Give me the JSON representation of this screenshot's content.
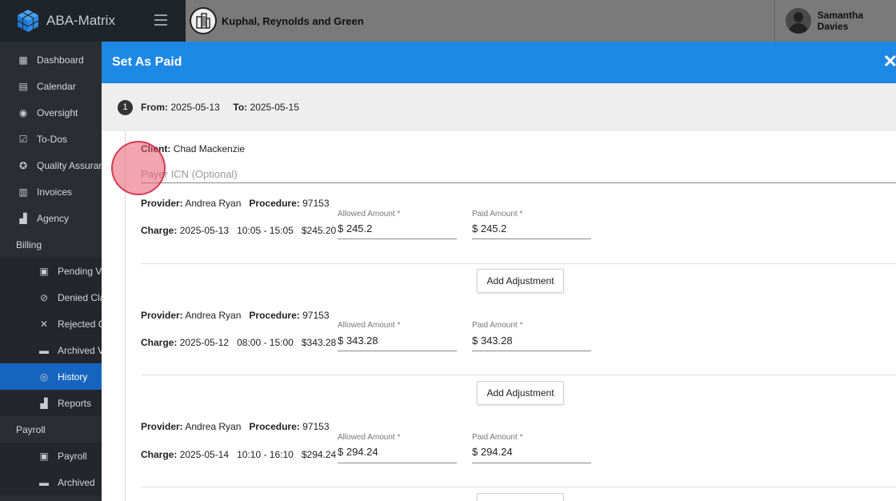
{
  "app": {
    "name": "ABA-Matrix"
  },
  "org": {
    "name": "Kuphal, Reynolds and Green"
  },
  "user": {
    "name": "Samantha Davies"
  },
  "sidebar": {
    "items": [
      {
        "label": "Dashboard"
      },
      {
        "label": "Calendar"
      },
      {
        "label": "Oversight"
      },
      {
        "label": "To-Dos"
      },
      {
        "label": "Quality Assurance"
      },
      {
        "label": "Invoices"
      },
      {
        "label": "Agency"
      }
    ],
    "billing_section": "Billing",
    "billing_items": [
      {
        "label": "Pending Visits"
      },
      {
        "label": "Denied Claims"
      },
      {
        "label": "Rejected Claims"
      },
      {
        "label": "Archived Visits"
      },
      {
        "label": "History"
      },
      {
        "label": "Reports"
      }
    ],
    "payroll_section": "Payroll",
    "payroll_items": [
      {
        "label": "Payroll"
      },
      {
        "label": "Archived"
      }
    ]
  },
  "modal": {
    "title": "Set As Paid",
    "close": "✕",
    "step": {
      "number": "1",
      "from_label": "From:",
      "from": "2025-05-13",
      "to_label": "To:",
      "to": "2025-05-15"
    },
    "client_label": "Client:",
    "client": "Chad Mackenzie",
    "icn_placeholder": "Payer ICN (Optional)",
    "provider_label": "Provider:",
    "procedure_label": "Procedure:",
    "charge_label": "Charge:",
    "allowed_label": "Allowed Amount *",
    "paid_label": "Paid Amount *",
    "adjust_label": "Add Adjustment",
    "charges": [
      {
        "provider": "Andrea Ryan",
        "procedure": "97153",
        "date": "2025-05-13",
        "time": "10:05 - 15:05",
        "amount": "$245.20",
        "allowed": "$ 245.2",
        "paid": "$ 245.2"
      },
      {
        "provider": "Andrea Ryan",
        "procedure": "97153",
        "date": "2025-05-12",
        "time": "08:00 - 15:00",
        "amount": "$343.28",
        "allowed": "$ 343.28",
        "paid": "$ 343.28"
      },
      {
        "provider": "Andrea Ryan",
        "procedure": "97153",
        "date": "2025-05-14",
        "time": "10:10 - 16:10",
        "amount": "$294.24",
        "allowed": "$ 294.24",
        "paid": "$ 294.24"
      }
    ]
  },
  "colors": {
    "header": "#1e88e5",
    "active_nav": "#1565c0",
    "sidebar": "#2a2e33"
  }
}
